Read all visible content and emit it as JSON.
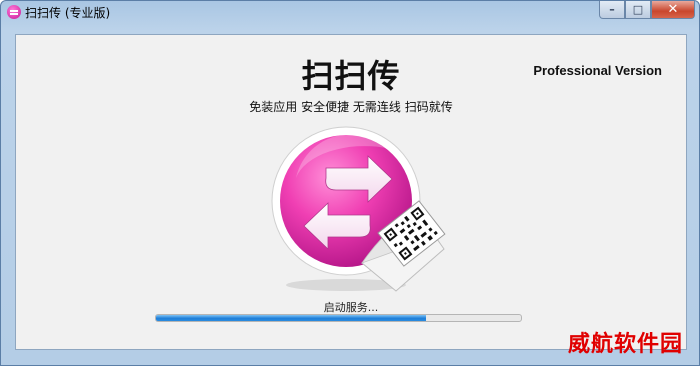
{
  "window": {
    "title": "扫扫传 (专业版)",
    "controls": {
      "minimize": "–",
      "maximize": "□",
      "close": "✕"
    }
  },
  "app": {
    "title": "扫扫传",
    "edition": "Professional Version",
    "tagline": "免装应用  安全便捷  无需连线  扫码就传",
    "logo_icon": "swap-arrows-qr-logo"
  },
  "status": {
    "text": "启动服务...",
    "progress": 0.74
  },
  "watermark": "威航软件园",
  "colors": {
    "accent": "#e34aa8",
    "progress": "#1f7fd8",
    "watermark": "#e00000"
  }
}
